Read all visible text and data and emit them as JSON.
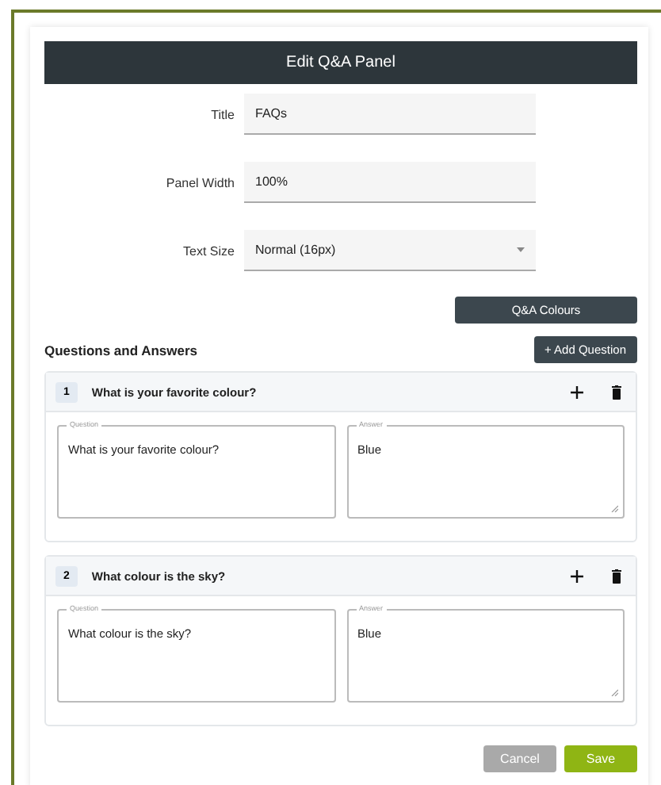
{
  "dialog": {
    "title": "Edit Q&A Panel"
  },
  "fields": [
    {
      "label": "Title",
      "kind": "text",
      "value": "FAQs"
    },
    {
      "label": "Panel Width",
      "kind": "text",
      "value": "100%"
    },
    {
      "label": "Text Size",
      "kind": "select",
      "value": "Normal (16px)"
    }
  ],
  "colours_button": "Q&A Colours",
  "section": {
    "title": "Questions and Answers",
    "add_button": "+ Add Question"
  },
  "items": [
    {
      "number": "1",
      "title": "What is your favorite colour?",
      "question_label": "Question",
      "question": "What is your favorite colour?",
      "answer_label": "Answer",
      "answer": "Blue"
    },
    {
      "number": "2",
      "title": "What colour is the sky?",
      "question_label": "Question",
      "question": "What colour is the sky?",
      "answer_label": "Answer",
      "answer": "Blue"
    }
  ],
  "buttons": [
    {
      "label": "Cancel",
      "kind": "secondary"
    },
    {
      "label": "Save",
      "kind": "primary"
    }
  ]
}
